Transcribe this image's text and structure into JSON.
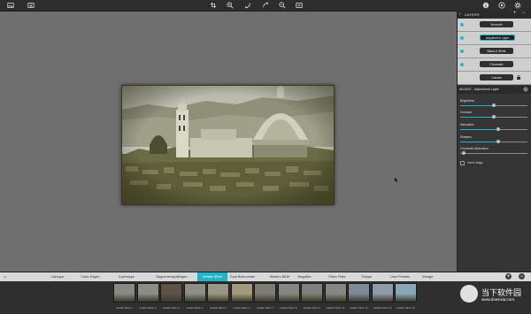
{
  "toolbar": {
    "left_icons": [
      "image-icon",
      "inbox-icon"
    ],
    "center_icons": [
      "crop-icon",
      "zoom-in-icon",
      "rotate-left-icon",
      "rotate-right-icon",
      "zoom-out-icon",
      "fit-screen-icon"
    ],
    "right_icons": [
      "info-icon",
      "help-icon",
      "settings-icon"
    ]
  },
  "layers": {
    "title": "LAYERS",
    "items": [
      {
        "label": "Screenfx",
        "selected": false
      },
      {
        "label": "Adjustment Layer",
        "selected": true
      },
      {
        "label": "Black & White",
        "selected": false
      },
      {
        "label": "Chromatic",
        "selected": false
      },
      {
        "label": "Canvas",
        "selected": false
      }
    ]
  },
  "adjust": {
    "title": "ADJUST - Adjustment Layer",
    "sliders": [
      {
        "label": "Brightness",
        "value": 0.5
      },
      {
        "label": "Contrast",
        "value": 0.5
      },
      {
        "label": "Saturation",
        "value": 0.56
      },
      {
        "label": "Sharpen",
        "value": 0.56
      },
      {
        "label": "Chromatic Aberration",
        "value": 0.05
      }
    ],
    "checkbox_label": "Invert Image"
  },
  "presets": {
    "tabs": [
      "Calotype",
      "Color Edges",
      "Cyanotype",
      "Daguerreotype",
      "Edges",
      "Gelatin Silver",
      "Gum Bichromate",
      "Modern B&W",
      "Negative",
      "Silver Plate",
      "Tintype",
      "User Presets",
      "Vintage"
    ],
    "active_tab": "Gelatin Silver",
    "thumbnails": [
      {
        "caption": "Gelatin Silver 1",
        "color": "#8a8a84"
      },
      {
        "caption": "Gelatin Silver 2",
        "color": "#8d8d86"
      },
      {
        "caption": "Gelatin Silver 3",
        "color": "#5f5347"
      },
      {
        "caption": "Gelatin Silver 4",
        "color": "#8e8d86"
      },
      {
        "caption": "Gelatin Silver 5",
        "color": "#9a9684"
      },
      {
        "caption": "Gelatin Silver 6",
        "color": "#a19a7c"
      },
      {
        "caption": "Gelatin Silver 7",
        "color": "#7f7d73"
      },
      {
        "caption": "Gelatin Silver 8",
        "color": "#878781"
      },
      {
        "caption": "Gelatin Silver 9",
        "color": "#7f7f7b"
      },
      {
        "caption": "Gelatin Silver 10",
        "color": "#868682"
      },
      {
        "caption": "Gelatin Silver 11",
        "color": "#7d8898"
      },
      {
        "caption": "Gelatin Silver 12",
        "color": "#8f9aa8"
      },
      {
        "caption": "Gelatin Silver 13",
        "color": "#8aa6b8"
      }
    ]
  },
  "watermark": {
    "title": "当下软件园",
    "url": "www.downxia.com"
  },
  "colors": {
    "accent": "#22b5c7",
    "photo_tone": "#7a7a52"
  }
}
